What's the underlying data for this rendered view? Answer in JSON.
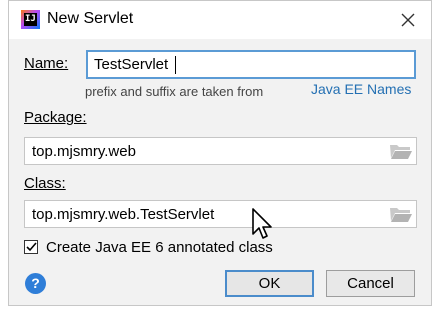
{
  "window": {
    "title": "New Servlet",
    "icon": "intellij-icon",
    "icon_glyph": "IJ"
  },
  "name_field": {
    "label": "Name:",
    "value": "TestServlet"
  },
  "hint": {
    "text": "prefix and suffix are taken from",
    "link": "Java EE Names"
  },
  "package_field": {
    "label": "Package:",
    "value": "top.mjsmry.web",
    "browse_icon": "folder-icon"
  },
  "class_field": {
    "label": "Class:",
    "value": "top.mjsmry.web.TestServlet",
    "browse_icon": "folder-icon"
  },
  "checkbox": {
    "label": "Create Java EE 6 annotated class",
    "checked": true
  },
  "buttons": {
    "help": "?",
    "ok": "OK",
    "cancel": "Cancel"
  },
  "colors": {
    "accent": "#5b9bd5",
    "link": "#2470b3",
    "help": "#2f7ed8",
    "dialog_bg": "#f2f2f2"
  }
}
